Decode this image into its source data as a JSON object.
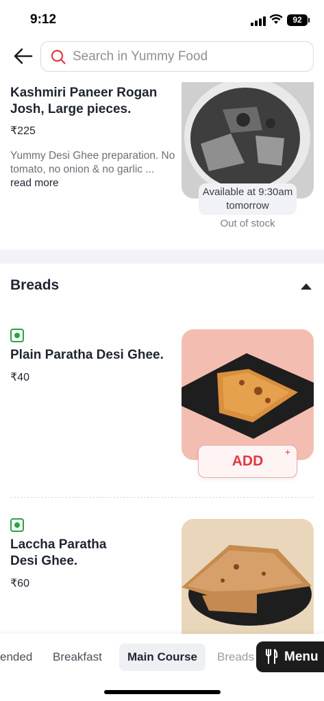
{
  "status_bar": {
    "time": "9:12",
    "battery": "92"
  },
  "search": {
    "placeholder": "Search in Yummy Food"
  },
  "dish_1": {
    "title": "Kashmiri Paneer Rogan Josh, Large pieces.",
    "price": "₹225",
    "description": "Yummy Desi Ghee preparation. No tomato, no onion & no garlic ...",
    "read_more": "read more",
    "availability": "Available at 9:30am tomorrow",
    "stock_status": "Out of stock"
  },
  "section": {
    "title": "Breads"
  },
  "items": [
    {
      "title": "Plain Paratha Desi Ghee.",
      "price": "₹40",
      "add_label": "ADD",
      "add_plus": "+"
    },
    {
      "title": "Laccha Paratha Desi Ghee.",
      "price": "₹60"
    }
  ],
  "category_bar": {
    "categories": [
      "ended",
      "Breakfast",
      "Main Course",
      "Breads"
    ],
    "active": "Main Course",
    "menu_label": "Menu"
  },
  "colors": {
    "accent": "#e23744",
    "veg": "#26a541"
  }
}
